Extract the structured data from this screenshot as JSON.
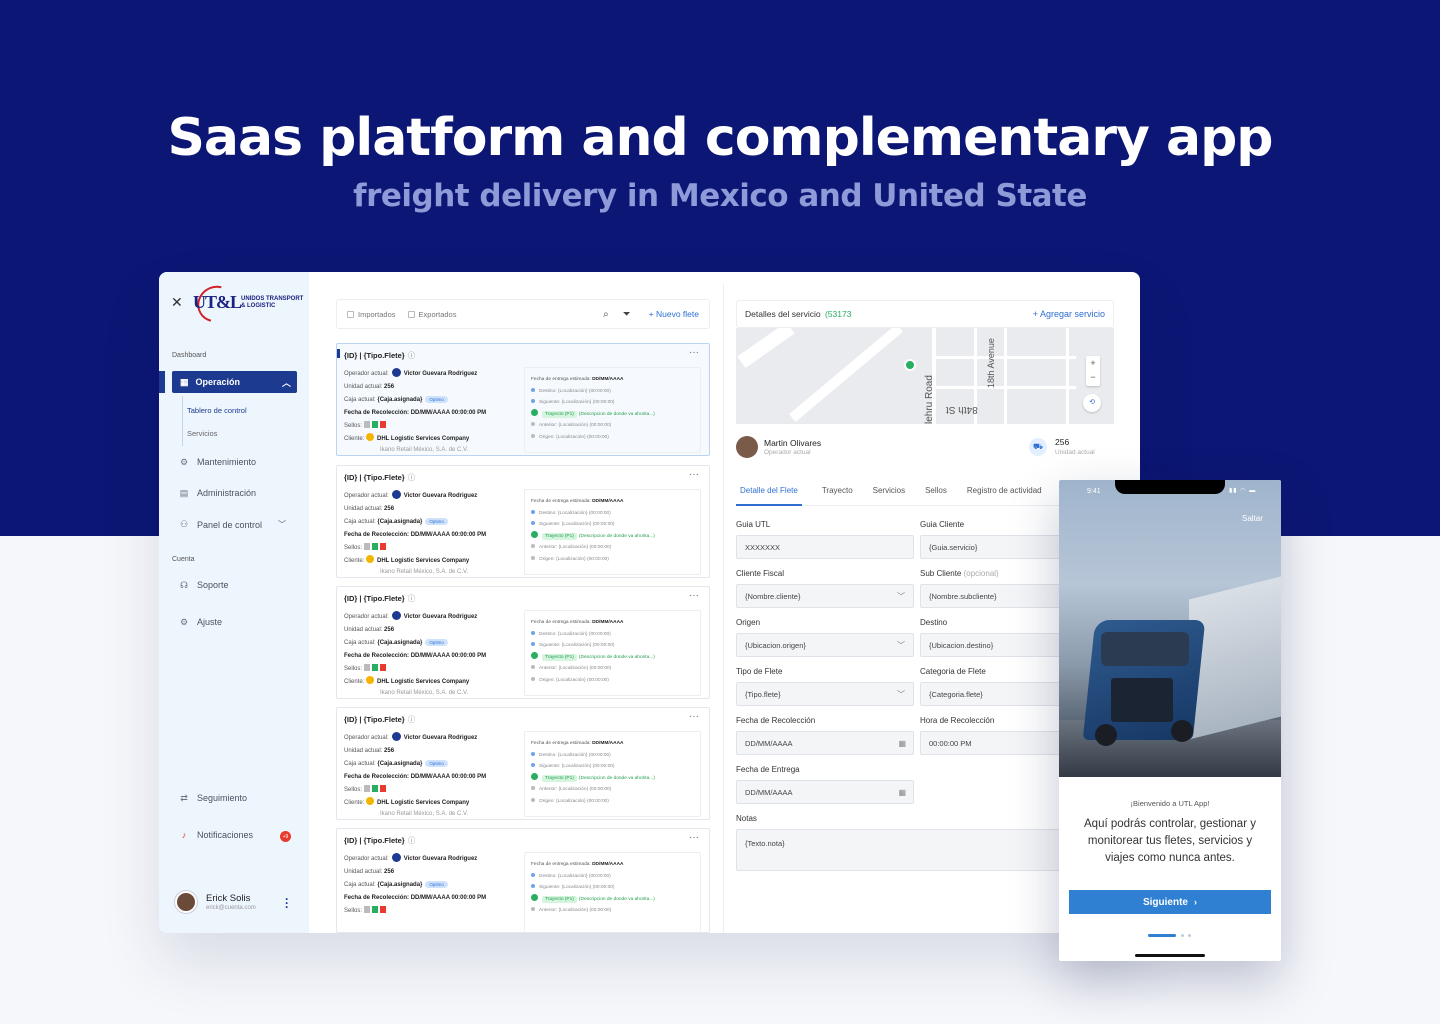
{
  "hero": {
    "title": "Saas platform and complementary app",
    "subtitle": "freight delivery in Mexico and United State"
  },
  "colors": {
    "hero_bg": "#0c1674",
    "primary": "#1c3a8f",
    "accent_blue": "#2f6fd1",
    "success_green": "#27ae60",
    "sidebar_bg": "#eef6fd"
  },
  "sidebar": {
    "logo_mark": "UT&L",
    "logo_brand_line1": "UNIDOS TRANSPORT",
    "logo_brand_line2": "& LOGISTIC",
    "section_dashboard": "Dashboard",
    "active_item": "Operación",
    "sub_items": [
      "Tablero de control",
      "Servicios"
    ],
    "items": [
      {
        "label": "Mantenimiento",
        "icon": "wrench-icon"
      },
      {
        "label": "Administración",
        "icon": "document-icon"
      },
      {
        "label": "Panel de control",
        "icon": "users-icon"
      }
    ],
    "section_account": "Cuenta",
    "account_items": [
      {
        "label": "Soporte",
        "icon": "headset-icon"
      },
      {
        "label": "Ajuste",
        "icon": "gear-icon"
      }
    ],
    "bottom_items": [
      {
        "label": "Seguimiento",
        "icon": "route-icon"
      },
      {
        "label": "Notificaciones",
        "icon": "bell-icon"
      }
    ],
    "notif_badge": "+9",
    "user_name": "Erick Solis",
    "user_email": "erick@cuenta.com"
  },
  "list": {
    "filter_imported": "Importados",
    "filter_exported": "Exportados",
    "new_button": "Nuevo flete",
    "card": {
      "header": "{ID} | {Tipo.Flete}",
      "operator_label": "Operador actual:",
      "operator_name": "Victor Guevara Rodriguez",
      "operator_initials": "VG",
      "unit_label": "Unidad actual:",
      "unit_value": "256",
      "box_label": "Caja actual:",
      "box_value": "{Caja.asignada}",
      "box_status": "Optimo",
      "pickup_label": "Fecha de Recolección:",
      "pickup_value": "DD/MM/AAAA 00:00:00 PM",
      "seals_label": "Sellos:",
      "client_label": "Cliente:",
      "client_name": "DHL Logistic Services Company",
      "client_sub": "Ikano Retail México, S.A. de C.V.",
      "eta_label": "Fecha de entrega estimada:",
      "eta_value": "DD/MM/AAAA",
      "dest_label": "Destino:",
      "next_label": "Siguiente:",
      "route_tag": "Trayecto (P1)",
      "route_desc": "(Descripcion de donde va ahorita...)",
      "prev_label": "Anterior:",
      "origin_label": "Origen:",
      "loc_value": "{Localización}",
      "time_value": "(00:00:00)"
    }
  },
  "detail": {
    "title": "Detalles del servicio",
    "service_id": "(53173",
    "add_service": "Agregar servicio",
    "map_labels": [
      "18th Avenue",
      "lehru Road",
      "84th St"
    ],
    "driver_name": "Martin Olivares",
    "driver_role": "Operador actual",
    "unit_number": "256",
    "unit_label": "Unidad actual",
    "tabs": [
      "Detalle del Flete",
      "Trayecto",
      "Servicios",
      "Sellos",
      "Registro de actividad"
    ],
    "fields": {
      "guia_utl_label": "Guia UTL",
      "guia_utl_value": "XXXXXXX",
      "guia_cliente_label": "Guia Cliente",
      "guia_cliente_value": "{Guia.servicio}",
      "cliente_fiscal_label": "Cliente Fiscal",
      "cliente_fiscal_value": "{Nombre.cliente}",
      "sub_cliente_label": "Sub Cliente",
      "sub_cliente_opt": "(opcional)",
      "sub_cliente_value": "{Nombre.subcliente}",
      "origen_label": "Origen",
      "origen_value": "{Ubicacion.origen}",
      "destino_label": "Destino",
      "destino_value": "{Ubicacion.destino}",
      "tipo_label": "Tipo de Flete",
      "tipo_value": "{Tipo.flete}",
      "categoria_label": "Categoria de Flete",
      "categoria_value": "{Categoria.flete}",
      "fecha_recol_label": "Fecha de Recolección",
      "fecha_recol_value": "DD/MM/AAAA",
      "hora_recol_label": "Hora de Recolección",
      "hora_recol_value": "00:00:00 PM",
      "fecha_entrega_label": "Fecha de Entrega",
      "fecha_entrega_value": "DD/MM/AAAA",
      "notas_label": "Notas",
      "notas_value": "{Texto.nota}"
    }
  },
  "phone": {
    "time": "9:41",
    "skip": "Saltar",
    "welcome": "¡Bienvenido a UTL App!",
    "message": "Aquí podrás controlar, gestionar y monitorear tus fletes, servicios y viajes como nunca antes.",
    "button": "Siguiente"
  }
}
